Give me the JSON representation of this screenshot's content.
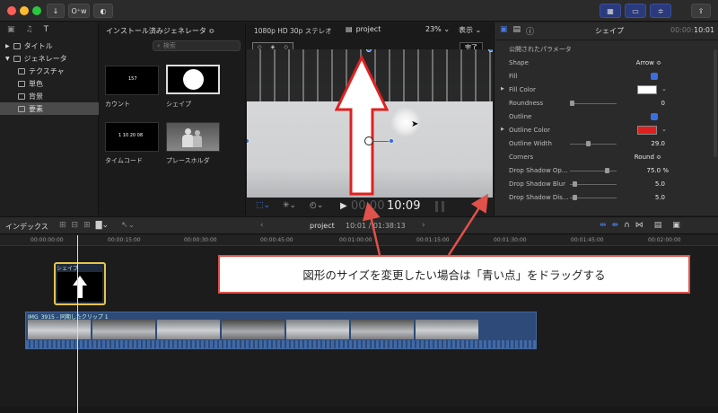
{
  "topbar": {
    "import_icon": "download-arrow-icon",
    "keywords_label": "O⁺w",
    "share_icon": "share-icon"
  },
  "sidebar": {
    "items": [
      {
        "label": "タイトル",
        "level": 0,
        "selected": false
      },
      {
        "label": "ジェネレータ",
        "level": 0,
        "selected": false
      },
      {
        "label": "テクスチャ",
        "level": 1,
        "selected": false
      },
      {
        "label": "単色",
        "level": 1,
        "selected": false
      },
      {
        "label": "背景",
        "level": 1,
        "selected": false
      },
      {
        "label": "要素",
        "level": 1,
        "selected": true
      }
    ]
  },
  "browser": {
    "header": "インストール済みジェネレータ ≎",
    "search_placeholder": "検索",
    "thumbs": [
      {
        "label": "カウント",
        "inner": "157"
      },
      {
        "label": "シェイプ",
        "inner": ""
      },
      {
        "label": "タイムコード",
        "inner": "1 10 20 08"
      },
      {
        "label": "プレースホルダ",
        "inner": ""
      }
    ]
  },
  "viewer": {
    "format": "1080p HD 30p ステレオ",
    "project": "project",
    "zoom": "23%",
    "view_menu": "表示",
    "done": "完了",
    "timecode": "10:09",
    "timecode_dim": "00:00"
  },
  "inspector": {
    "title": "シェイプ",
    "duration": "10:01",
    "section": "公開されたパラメータ",
    "params": [
      {
        "label": "Shape",
        "value": "Arrow ≎",
        "type": "popup"
      },
      {
        "label": "Fill",
        "value": "",
        "type": "check"
      },
      {
        "label": "Fill Color",
        "value": "",
        "type": "color",
        "color": "#ffffff"
      },
      {
        "label": "Roundness",
        "value": "0",
        "type": "slider",
        "pos": 0.0
      },
      {
        "label": "Outline",
        "value": "",
        "type": "check"
      },
      {
        "label": "Outline Color",
        "value": "",
        "type": "color",
        "color": "#e02020"
      },
      {
        "label": "Outline Width",
        "value": "29.0",
        "type": "slider",
        "pos": 0.35
      },
      {
        "label": "Corners",
        "value": "Round ≎",
        "type": "popup"
      },
      {
        "label": "Drop Shadow Op...",
        "value": "75.0 %",
        "type": "slider",
        "pos": 0.75
      },
      {
        "label": "Drop Shadow Blur",
        "value": "5.0",
        "type": "slider",
        "pos": 0.05
      },
      {
        "label": "Drop Shadow Dis...",
        "value": "5.0",
        "type": "slider",
        "pos": 0.05
      }
    ]
  },
  "midbar": {
    "index_label": "インデックス",
    "project": "project",
    "position": "10:01 / 01:38:13"
  },
  "timeline": {
    "ticks": [
      "00:00:00:00",
      "00:00:15:00",
      "00:00:30:00",
      "00:00:45:00",
      "00:01:00:00",
      "00:01:15:00",
      "00:01:30:00",
      "00:01:45:00",
      "00:02:00:00"
    ],
    "gen_clip_label": "シェイプ",
    "video_clip_label": "IMG_3915 - 同期したクリップ 1"
  },
  "callout": {
    "text": "図形のサイズを変更したい場合は「青い点」をドラッグする",
    "border_color": "#e0524a"
  }
}
